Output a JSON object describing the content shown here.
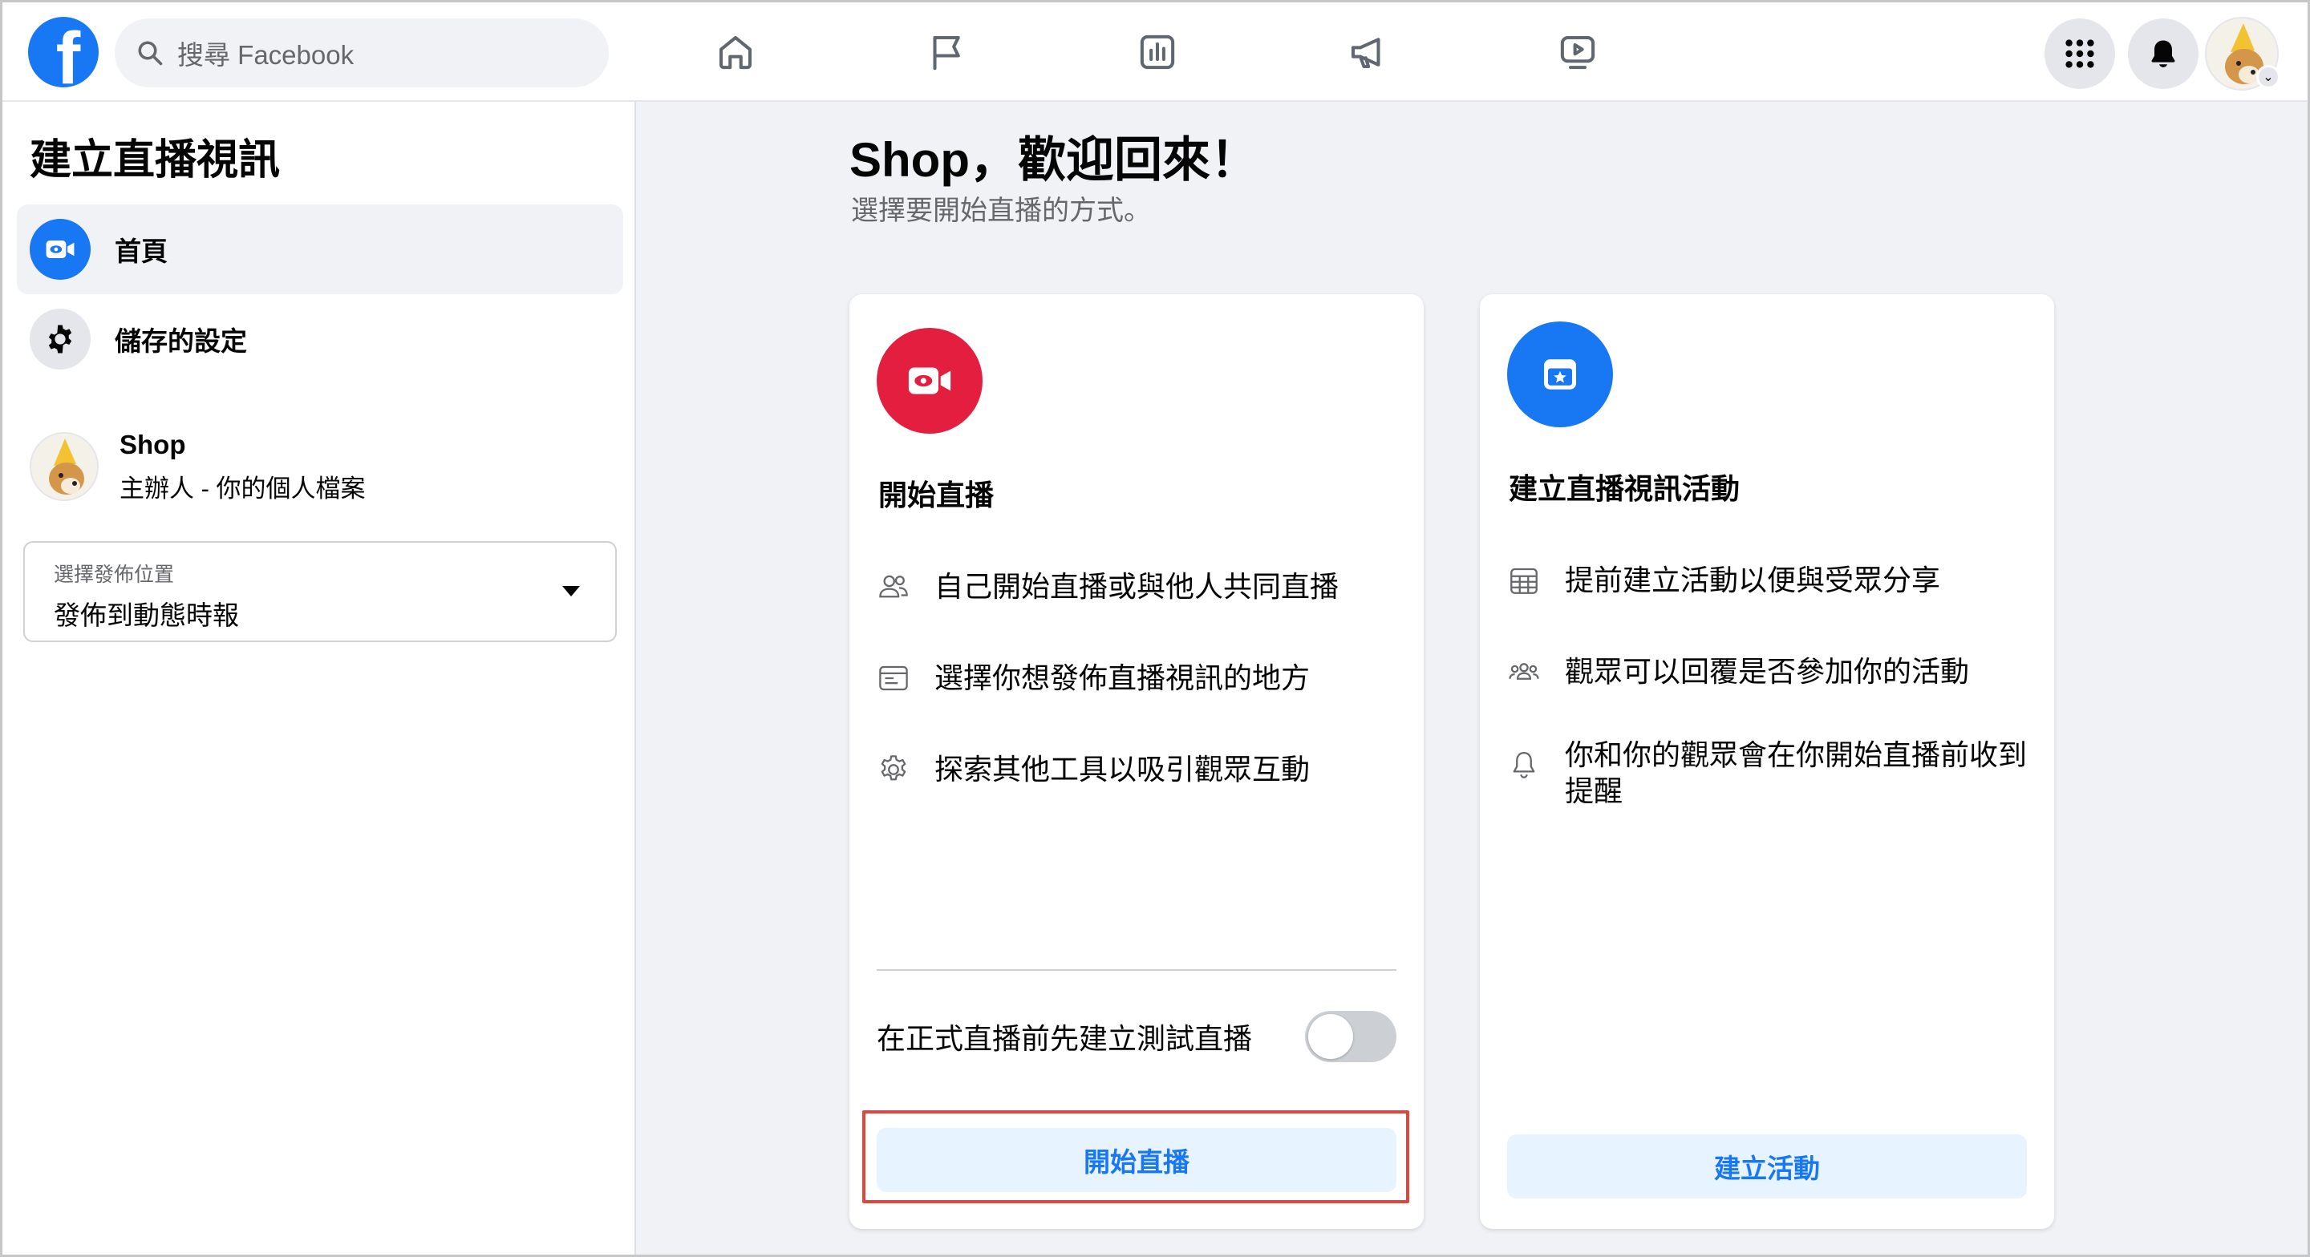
{
  "topbar": {
    "logo_letter": "f",
    "search_placeholder": "搜尋 Facebook",
    "nav_icons": [
      "home-icon",
      "flag-icon",
      "insights-icon",
      "megaphone-icon",
      "video-icon"
    ],
    "right_icons": [
      "menu-grid-icon",
      "bell-icon"
    ]
  },
  "sidebar": {
    "title": "建立直播視訊",
    "items": [
      {
        "label": "首頁",
        "icon": "video-camera-icon",
        "active": true
      },
      {
        "label": "儲存的設定",
        "icon": "gear-icon",
        "active": false
      }
    ],
    "profile": {
      "name": "Shop",
      "subtitle": "主辦人 - 你的個人檔案"
    },
    "post_location": {
      "label": "選擇發佈位置",
      "value": "發佈到動態時報"
    }
  },
  "main": {
    "welcome": "Shop，歡迎回來！",
    "subtitle": "選擇要開始直播的方式。",
    "go_live_card": {
      "title": "開始直播",
      "features": [
        "自己開始直播或與他人共同直播",
        "選擇你想發佈直播視訊的地方",
        "探索其他工具以吸引觀眾互動"
      ],
      "test_toggle_label": "在正式直播前先建立測試直播",
      "button": "開始直播"
    },
    "event_card": {
      "title": "建立直播視訊活動",
      "features": [
        "提前建立活動以便與受眾分享",
        "觀眾可以回覆是否參加你的活動",
        "你和你的觀眾會在你開始直播前收到提醒"
      ],
      "button": "建立活動"
    }
  },
  "colors": {
    "brand_blue": "#1877f2",
    "live_red": "#e41e3f",
    "highlight_red": "#e0463b",
    "button_bg": "#e7f3ff"
  }
}
